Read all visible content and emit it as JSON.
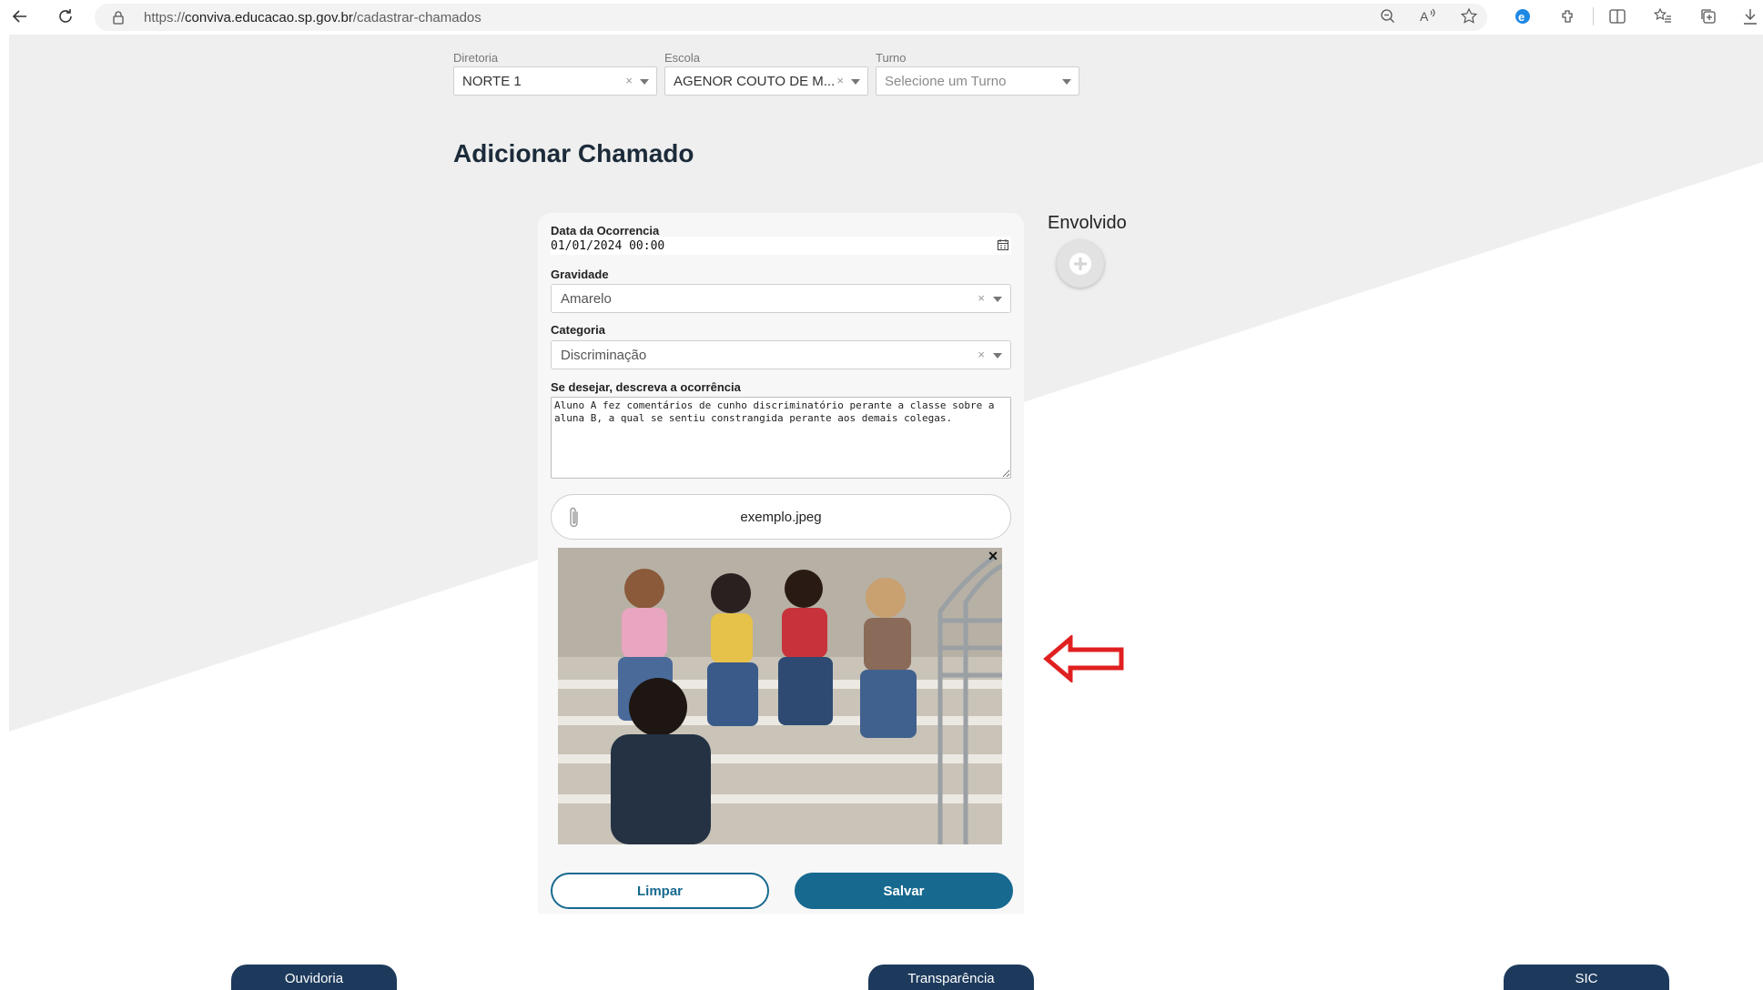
{
  "browser": {
    "url_prefix": "https://",
    "url_host": "conviva.educacao.sp.gov.br",
    "url_path": "/cadastrar-chamados",
    "icons": [
      "back-icon",
      "refresh-icon",
      "lock-icon",
      "zoom-out-icon",
      "read-aloud-icon",
      "favorite-star-icon",
      "ie-mode-icon",
      "extensions-icon",
      "split-screen-icon",
      "favorites-icon",
      "collections-icon",
      "download-icon"
    ]
  },
  "filters": {
    "diretoria": {
      "label": "Diretoria",
      "value": "NORTE 1"
    },
    "escola": {
      "label": "Escola",
      "value": "AGENOR COUTO DE M..."
    },
    "turno": {
      "label": "Turno",
      "placeholder": "Selecione um Turno"
    }
  },
  "page_title": "Adicionar Chamado",
  "form": {
    "date_label": "Data da Ocorrencia",
    "date_value": "01/01/2024 00:00",
    "gravidade_label": "Gravidade",
    "gravidade_value": "Amarelo",
    "categoria_label": "Categoria",
    "categoria_value": "Discriminação",
    "desc_label": "Se desejar, descreva a ocorrência",
    "desc_value": "Aluno A fez comentários de cunho discriminatório perante a classe sobre a aluna B, a qual se sentiu constrangida perante aos demais colegas.",
    "attachment_name": "exemplo.jpeg",
    "clear_label": "Limpar",
    "save_label": "Salvar"
  },
  "envolvido": {
    "title": "Envolvido"
  },
  "footer": {
    "ouvidoria": "Ouvidoria",
    "transparencia": "Transparência",
    "sic": "SIC"
  },
  "colors": {
    "primary": "#17698f",
    "footer": "#1d3a5c",
    "annotation_arrow": "#e02020",
    "background_shape": "#efefef"
  }
}
